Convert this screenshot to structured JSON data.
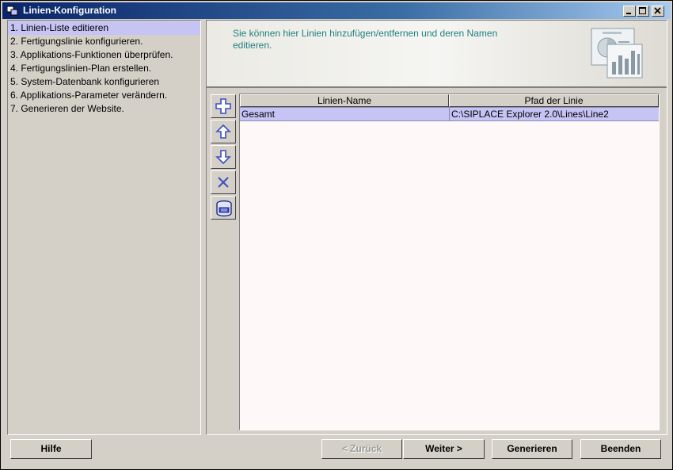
{
  "window": {
    "title": "Linien-Konfiguration"
  },
  "steps": [
    {
      "label": "1. Linien-Liste editieren",
      "selected": true
    },
    {
      "label": "2. Fertigungslinie konfigurieren.",
      "selected": false
    },
    {
      "label": "3. Applikations-Funktionen überprüfen.",
      "selected": false
    },
    {
      "label": "4. Fertigungslinien-Plan erstellen.",
      "selected": false
    },
    {
      "label": "5. System-Datenbank konfigurieren",
      "selected": false
    },
    {
      "label": "6. Applikations-Parameter verändern.",
      "selected": false
    },
    {
      "label": "7. Generieren der Website.",
      "selected": false
    }
  ],
  "header": {
    "description": "Sie können hier Linien hinzufügen/entfernen und deren Namen editieren."
  },
  "toolbar": {
    "icons": [
      "add-icon",
      "move-up-icon",
      "move-down-icon",
      "delete-icon",
      "database-icon"
    ]
  },
  "table": {
    "columns": [
      "Linien-Name",
      "Pfad der Linie"
    ],
    "rows": [
      {
        "name": "Gesamt",
        "path": "C:\\SIPLACE Explorer 2.0\\Lines\\Line2"
      }
    ]
  },
  "buttons": {
    "help": "Hilfe",
    "back": "< Zurück",
    "next": "Weiter >",
    "generate": "Generieren",
    "exit": "Beenden"
  },
  "colors": {
    "selection": "#c6c3f5",
    "title_start": "#0a246a",
    "title_end": "#a6caf0",
    "description_text": "#1e8080",
    "toolbar_icon": "#3a4fc0"
  }
}
